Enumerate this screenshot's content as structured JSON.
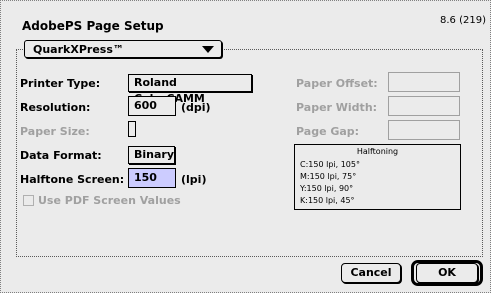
{
  "dialog": {
    "title": "AdobePS Page Setup",
    "version": "8.6 (219)"
  },
  "popup": {
    "selected": "QuarkXPress™"
  },
  "fields": {
    "printer_type_label": "Printer Type:",
    "printer_type_value": "Roland ColorCAMM",
    "resolution_label": "Resolution:",
    "resolution_value": "600",
    "resolution_unit": "(dpi)",
    "paper_size_label": "Paper Size:",
    "data_format_label": "Data Format:",
    "data_format_value": "Binary",
    "halftone_screen_label": "Halftone Screen:",
    "halftone_screen_value": "150",
    "halftone_screen_unit": "(lpi)",
    "paper_offset_label": "Paper Offset:",
    "paper_width_label": "Paper Width:",
    "page_gap_label": "Page Gap:"
  },
  "checkbox": {
    "label": "Use PDF Screen Values",
    "checked": false
  },
  "halftoning": {
    "title": "Halftoning",
    "rows": [
      "C:150 lpi, 105°",
      "M:150 lpi, 75°",
      "Y:150 lpi, 90°",
      "K:150 lpi, 45°"
    ]
  },
  "buttons": {
    "cancel": "Cancel",
    "ok": "OK"
  }
}
